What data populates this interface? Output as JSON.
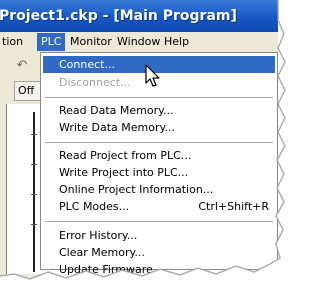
{
  "window": {
    "title": "Project1.ckp - [Main Program]"
  },
  "menubar": {
    "items": [
      {
        "label": "tion"
      },
      {
        "label": "PLC"
      },
      {
        "label": "Monitor"
      },
      {
        "label": "Window"
      },
      {
        "label": "Help"
      }
    ],
    "active": "PLC"
  },
  "toolbar": {
    "off_label": "Off"
  },
  "menu": {
    "items": [
      {
        "label": "Connect...",
        "state": "highlighted"
      },
      {
        "label": "Disconnect...",
        "state": "disabled"
      },
      {
        "label": "Read Data Memory..."
      },
      {
        "label": "Write Data Memory..."
      },
      {
        "label": "Read Project from PLC..."
      },
      {
        "label": "Write Project into PLC..."
      },
      {
        "label": "Online Project Information..."
      },
      {
        "label": "PLC Modes...",
        "shortcut": "Ctrl+Shift+R"
      },
      {
        "label": "Error History..."
      },
      {
        "label": "Clear Memory..."
      },
      {
        "label": "Update Firmware..."
      }
    ]
  },
  "colors": {
    "highlight": "#316ac5",
    "title_bar": "#1557c4",
    "menu_bg": "#ffffff",
    "chrome": "#ece9d8",
    "disabled_text": "#a0a0a0"
  },
  "icons": {
    "toolbar_icon": "undo-icon",
    "cursor": "mouse-pointer-icon"
  }
}
